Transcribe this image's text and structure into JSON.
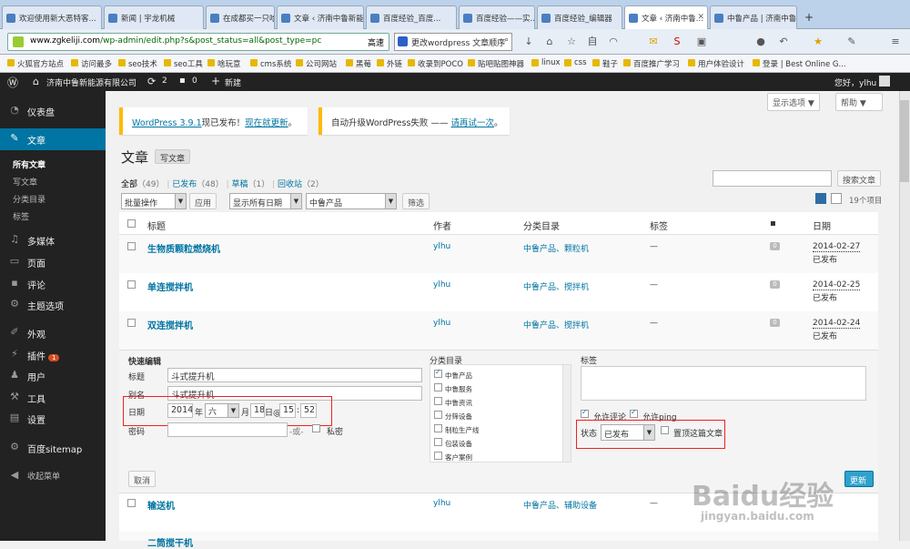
{
  "browser": {
    "tabs": [
      {
        "label": "欢迎使用新大恶特客..."
      },
      {
        "label": "新闻 | 宇龙机械"
      },
      {
        "label": "在成都买一只哈..."
      },
      {
        "label": "文章 ‹ 济南中鲁新能..."
      },
      {
        "label": "百度经验_百度..."
      },
      {
        "label": "百度经验——实..."
      },
      {
        "label": "百度经验_编辑器"
      },
      {
        "label": "文章 ‹ 济南中鲁..."
      },
      {
        "label": "中鲁产品 | 济南中鲁..."
      }
    ],
    "url_host": "www.zgkeliji.com",
    "url_path": "/wp-admin/edit.php?s&post_status=all&post_type=pc",
    "go_label": "高速",
    "search_text": "更改wordpress 文章顺序",
    "bookmarks": [
      "火狐官方站点",
      "访问最多",
      "seo技术",
      "seo工具",
      "啥玩意",
      "cms系统",
      "公司网站",
      "黑莓",
      "外链",
      "收录到POCO",
      "贴吧贴图神器",
      "linux",
      "css",
      "鞋子",
      "百度推广学习",
      "用户体验设计",
      "登录 | Best Online G..."
    ]
  },
  "adminbar": {
    "site_name": "济南中鲁新能源有限公司",
    "updates_count": "2",
    "comments_count": "0",
    "new_label": "新建",
    "greeting": "您好，ylhu"
  },
  "sidebar": {
    "items": [
      {
        "label": "仪表盘"
      },
      {
        "label": "文章"
      },
      {
        "label": "多媒体"
      },
      {
        "label": "页面"
      },
      {
        "label": "评论"
      },
      {
        "label": "主题选项"
      },
      {
        "label": "外观"
      },
      {
        "label": "插件",
        "badge": "1"
      },
      {
        "label": "用户"
      },
      {
        "label": "工具"
      },
      {
        "label": "设置"
      },
      {
        "label": "百度sitemap"
      },
      {
        "label": "收起菜单"
      }
    ],
    "sub_items": [
      "所有文章",
      "写文章",
      "分类目录",
      "标签"
    ]
  },
  "screen_options_label": "显示选项 ▼",
  "help_label": "帮助 ▼",
  "notices": {
    "update_version": "WordPress 3.9.1",
    "update_text": "现已发布！",
    "update_link": "现在就更新",
    "update_end": "。",
    "fail_text": "自动升级WordPress失败 —— ",
    "fail_link": "请再试一次",
    "fail_end": "。"
  },
  "page_title": "文章",
  "add_new_label": "写文章",
  "filters": {
    "all": "全部",
    "all_count": "（49）",
    "published": "已发布",
    "published_count": "（48）",
    "draft": "草稿",
    "draft_count": "（1）",
    "trash": "回收站",
    "trash_count": "（2）",
    "sep": " | ",
    "search_button": "搜索文章",
    "bulk_action": "批量操作",
    "apply": "应用",
    "date_filter": "显示所有日期",
    "category_filter": "中鲁产品",
    "filter_button": "筛选",
    "items_count": "19个项目"
  },
  "table": {
    "headers": {
      "title": "标题",
      "author": "作者",
      "categories": "分类目录",
      "tags": "标签",
      "date": "日期"
    },
    "rows": [
      {
        "title": "生物质颗粒燃烧机",
        "author": "ylhu",
        "categories": "中鲁产品、颗粒机",
        "tags": "—",
        "comments": "0",
        "date": "2014-02-27",
        "status": "已发布"
      },
      {
        "title": "单连搅拌机",
        "author": "ylhu",
        "categories": "中鲁产品、搅拌机",
        "tags": "—",
        "comments": "0",
        "date": "2014-02-25",
        "status": "已发布"
      },
      {
        "title": "双连搅拌机",
        "author": "ylhu",
        "categories": "中鲁产品、搅拌机",
        "tags": "—",
        "comments": "0",
        "date": "2014-02-24",
        "status": "已发布"
      },
      {
        "title": "输送机",
        "author": "ylhu",
        "categories": "中鲁产品、辅助设备",
        "tags": "—"
      },
      {
        "title": "二筒搅干机"
      }
    ]
  },
  "quick_edit": {
    "heading": "快速编辑",
    "title_label": "标题",
    "title_value": "斗式提升机",
    "slug_label": "别名",
    "slug_value": "斗式提升机",
    "date_label": "日期",
    "year": "2014",
    "year_suffix": "年",
    "month": "六",
    "month_suffix": "月",
    "day": "18",
    "at": "日@",
    "hour": "15",
    "colon": ":",
    "minute": "52",
    "password_label": "密码",
    "password_sep": "-或-",
    "private_label": "私密",
    "categories_label": "分类目录",
    "categories": [
      "中鲁产品",
      "中鲁服务",
      "中鲁资讯",
      "分筛设备",
      "制粒生产线",
      "包装设备",
      "客户案例"
    ],
    "tags_label": "标签",
    "allow_comments": "允许评论",
    "allow_pings": "允许ping",
    "status_label": "状态",
    "status_value": "已发布",
    "sticky_label": "置顶这篇文章",
    "cancel": "取消",
    "update": "更新"
  },
  "watermark": {
    "brand": "Baidu经验",
    "url": "jingyan.baidu.com"
  }
}
